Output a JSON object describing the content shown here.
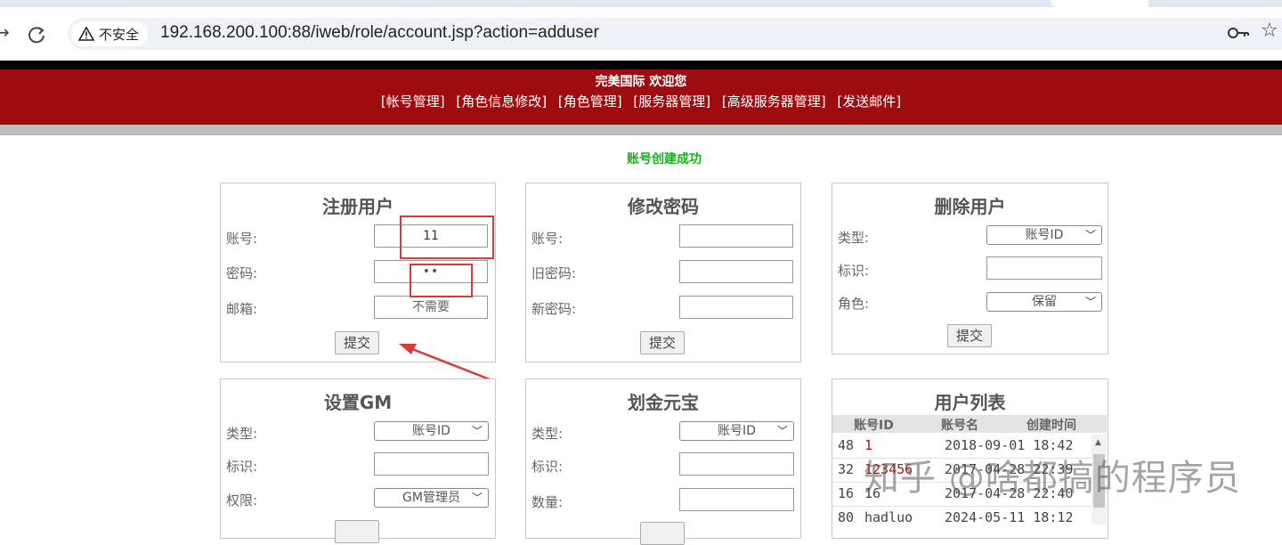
{
  "browser": {
    "security_label": "不安全",
    "url": "192.168.200.100:88/iweb/role/account.jsp?action=adduser"
  },
  "header": {
    "welcome": "完美国际 欢迎您",
    "menu": [
      "[帐号管理]",
      "[角色信息修改]",
      "[角色管理]",
      "[服务器管理]",
      "[高级服务器管理]",
      "[发送邮件]"
    ]
  },
  "status": {
    "message": "账号创建成功"
  },
  "register": {
    "title": "注册用户",
    "account_label": "账号:",
    "account_value": "11",
    "password_label": "密码:",
    "password_value": "••",
    "email_label": "邮箱:",
    "email_value": "不需要",
    "submit": "提交"
  },
  "change_password": {
    "title": "修改密码",
    "account_label": "账号:",
    "old_label": "旧密码:",
    "new_label": "新密码:",
    "submit": "提交"
  },
  "delete_user": {
    "title": "删除用户",
    "type_label": "类型:",
    "type_value": "账号ID",
    "id_label": "标识:",
    "role_label": "角色:",
    "role_value": "保留",
    "submit": "提交"
  },
  "set_gm": {
    "title": "设置GM",
    "type_label": "类型:",
    "type_value": "账号ID",
    "id_label": "标识:",
    "perm_label": "权限:",
    "perm_value": "GM管理员"
  },
  "transfer_gold": {
    "title": "划金元宝",
    "type_label": "类型:",
    "type_value": "账号ID",
    "id_label": "标识:",
    "qty_label": "数量:"
  },
  "user_list": {
    "title": "用户列表",
    "columns": [
      "账号ID",
      "账号名",
      "创建时间"
    ],
    "rows": [
      {
        "id": "48",
        "name": "1",
        "time": "2018-09-01 18:42"
      },
      {
        "id": "32",
        "name": "123456",
        "time": "2017-04-28 22:39"
      },
      {
        "id": "16",
        "name": "16",
        "time": "2017-04-28 22:40"
      },
      {
        "id": "80",
        "name": "hadluo",
        "time": "2024-05-11 18:12"
      }
    ]
  },
  "watermark": "知乎 @啥都搞的程序员",
  "colors": {
    "header_red": "#9e0c10",
    "success_green": "#18b018",
    "highlight_red": "#d43b3b"
  }
}
